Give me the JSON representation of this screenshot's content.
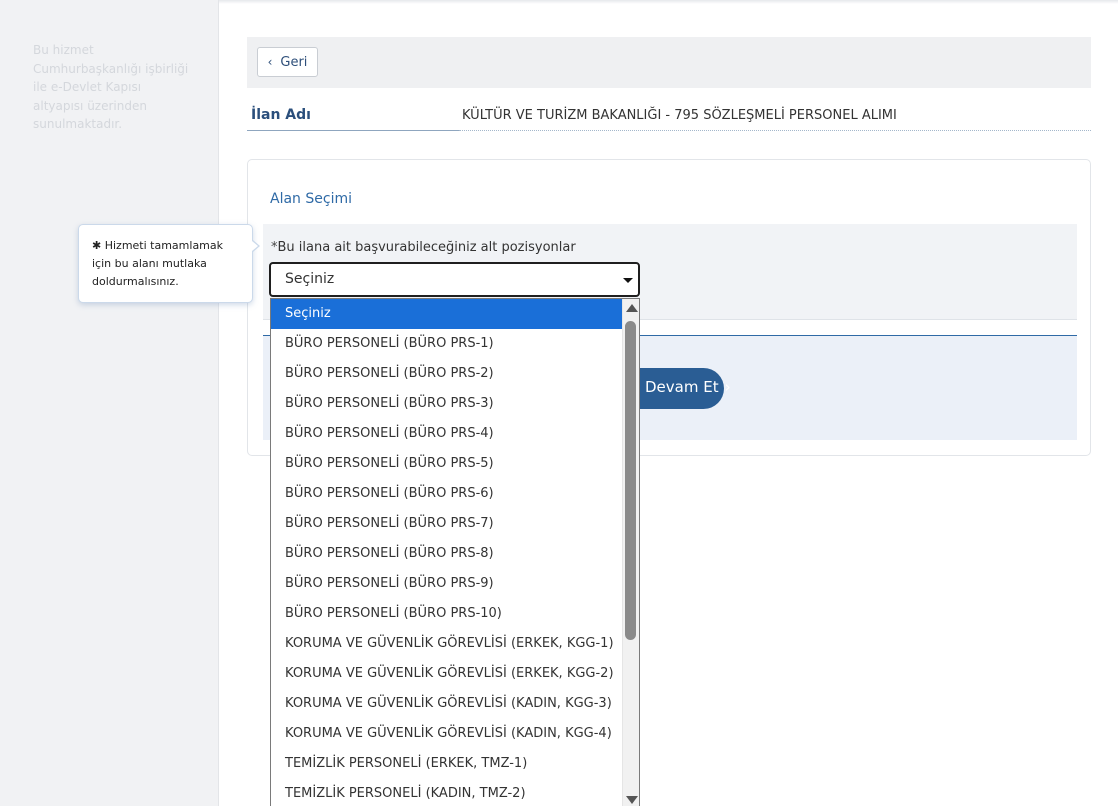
{
  "sidebar": {
    "note": "Bu hizmet Cumhurbaşkanlığı işbirliği ile e-Devlet Kapısı altyapısı üzerinden sunulmaktadır."
  },
  "header": {
    "back_label": "Geri"
  },
  "ilan": {
    "label": "İlan Adı",
    "value": "KÜLTÜR VE TURİZM BAKANLIĞI - 795 SÖZLEŞMELİ PERSONEL ALIMI"
  },
  "form": {
    "section_title": "Alan Seçimi",
    "required_mark": "*",
    "field_label": "Bu ilana ait başvurabileceğiniz alt pozisyonlar",
    "selected_value": "Seçiniz",
    "continue_label": "Devam Et"
  },
  "tooltip": {
    "text": "✱ Hizmeti tamamlamak için bu alanı mutlaka doldurmalısınız."
  },
  "dropdown": {
    "selected_index": 0,
    "options": [
      "Seçiniz",
      "BÜRO PERSONELİ (BÜRO PRS-1)",
      "BÜRO PERSONELİ (BÜRO PRS-2)",
      "BÜRO PERSONELİ (BÜRO PRS-3)",
      "BÜRO PERSONELİ (BÜRO PRS-4)",
      "BÜRO PERSONELİ (BÜRO PRS-5)",
      "BÜRO PERSONELİ (BÜRO PRS-6)",
      "BÜRO PERSONELİ (BÜRO PRS-7)",
      "BÜRO PERSONELİ (BÜRO PRS-8)",
      "BÜRO PERSONELİ (BÜRO PRS-9)",
      "BÜRO PERSONELİ (BÜRO PRS-10)",
      "KORUMA VE GÜVENLİK GÖREVLİSİ (ERKEK, KGG-1)",
      "KORUMA VE GÜVENLİK GÖREVLİSİ (ERKEK, KGG-2)",
      "KORUMA VE GÜVENLİK GÖREVLİSİ (KADIN, KGG-3)",
      "KORUMA VE GÜVENLİK GÖREVLİSİ (KADIN, KGG-4)",
      "TEMİZLİK PERSONELİ (ERKEK, TMZ-1)",
      "TEMİZLİK PERSONELİ (KADIN, TMZ-2)"
    ]
  },
  "colors": {
    "accent": "#2a5d94",
    "selected_option": "#1a6fd8"
  }
}
